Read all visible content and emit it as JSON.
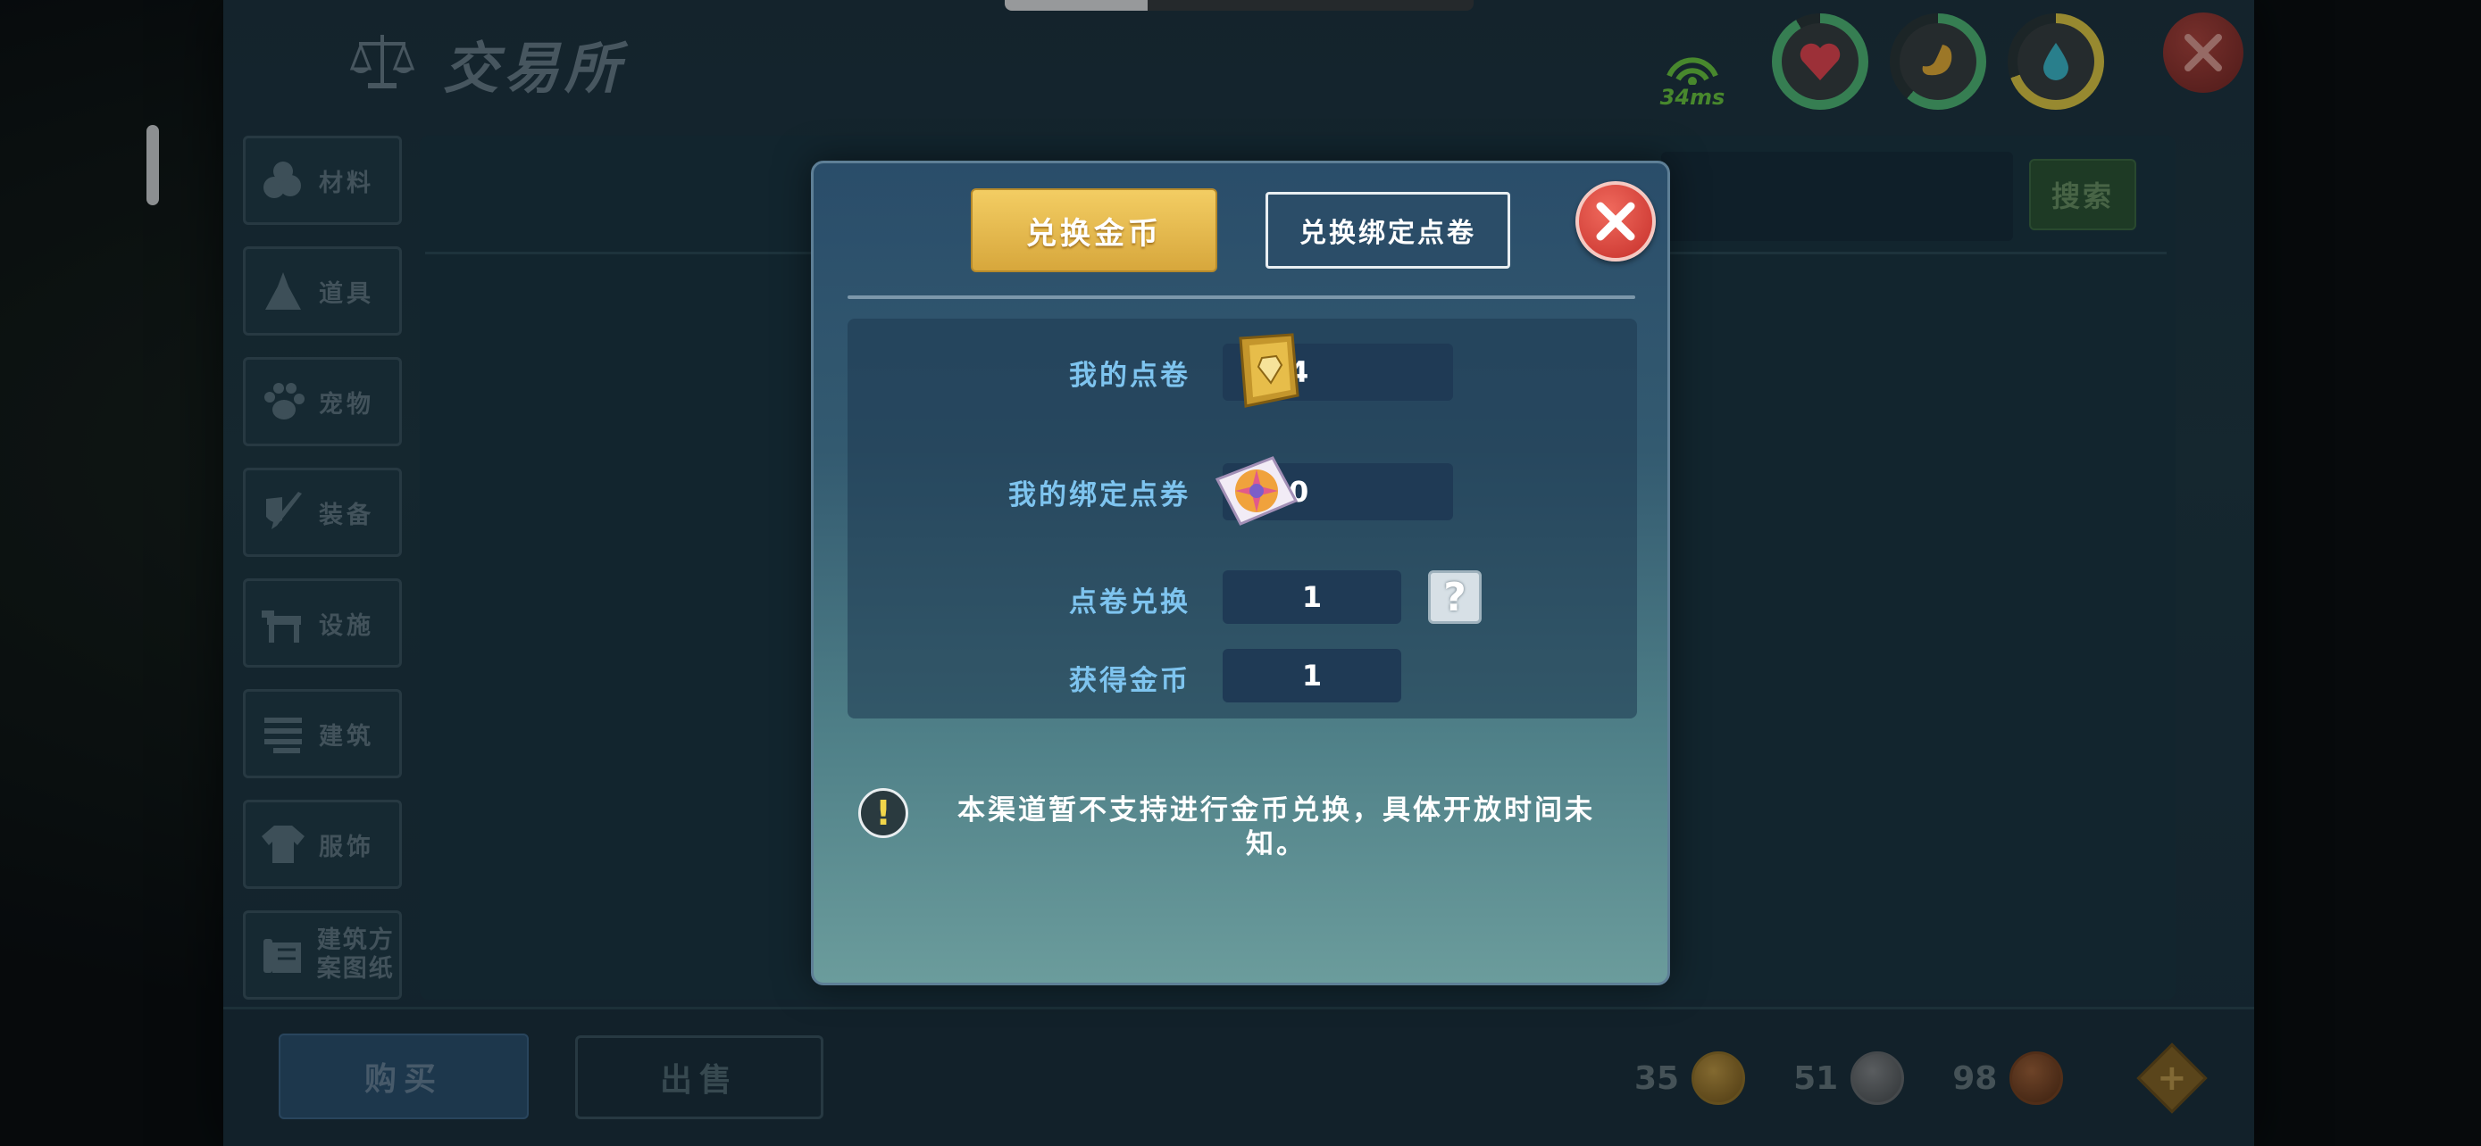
{
  "window": {
    "title": "交易所"
  },
  "status": {
    "ping": "34ms"
  },
  "search": {
    "button_label": "搜索"
  },
  "sidebar": {
    "items": [
      {
        "label": "材料",
        "icon": "materials-icon"
      },
      {
        "label": "道具",
        "icon": "tools-icon"
      },
      {
        "label": "宠物",
        "icon": "paw-icon"
      },
      {
        "label": "装备",
        "icon": "equipment-icon"
      },
      {
        "label": "设施",
        "icon": "facility-icon"
      },
      {
        "label": "建筑",
        "icon": "building-icon"
      },
      {
        "label": "服饰",
        "icon": "clothing-icon"
      },
      {
        "label": "建筑方案图纸",
        "icon": "blueprint-icon"
      }
    ]
  },
  "bottom": {
    "buy_label": "购买",
    "sell_label": "出售",
    "gold": "35",
    "silver": "51",
    "copper": "98"
  },
  "modal": {
    "tab_active": "兑换金币",
    "tab_inactive": "兑换绑定点卷",
    "rows": {
      "my_points_label": "我的点卷",
      "my_points_value": "4",
      "bound_label": "我的绑定点券",
      "bound_value": "0",
      "exchange_label": "点卷兑换",
      "exchange_value": "1",
      "gain_label": "获得金币",
      "gain_value": "1"
    },
    "notice": "本渠道暂不支持进行金币兑换，具体开放时间未知。"
  },
  "colors": {
    "accent_gold": "#f3cd63",
    "close_red": "#c62f2a",
    "label_blue": "#7ec4ef",
    "ping_green": "#6fd245"
  }
}
